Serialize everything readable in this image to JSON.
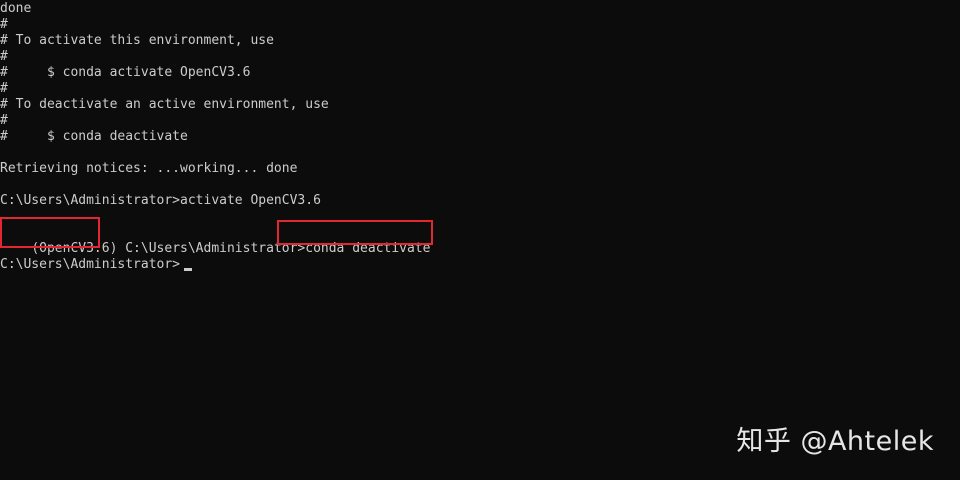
{
  "terminal": {
    "lines": [
      "done",
      "#",
      "# To activate this environment, use",
      "#",
      "#     $ conda activate OpenCV3.6",
      "#",
      "# To deactivate an active environment, use",
      "#",
      "#     $ conda deactivate",
      "",
      "Retrieving notices: ...working... done",
      "",
      "C:\\Users\\Administrator>activate OpenCV3.6",
      "",
      "",
      "",
      "C:\\Users\\Administrator>"
    ],
    "env_prefix": "(OpenCV3.6)",
    "prompt_path": "C:\\Users\\Administrator>",
    "command": "conda deactivate",
    "highlight_color": "#e0282e"
  },
  "watermark": {
    "text": "知乎 @Ahtelek"
  }
}
